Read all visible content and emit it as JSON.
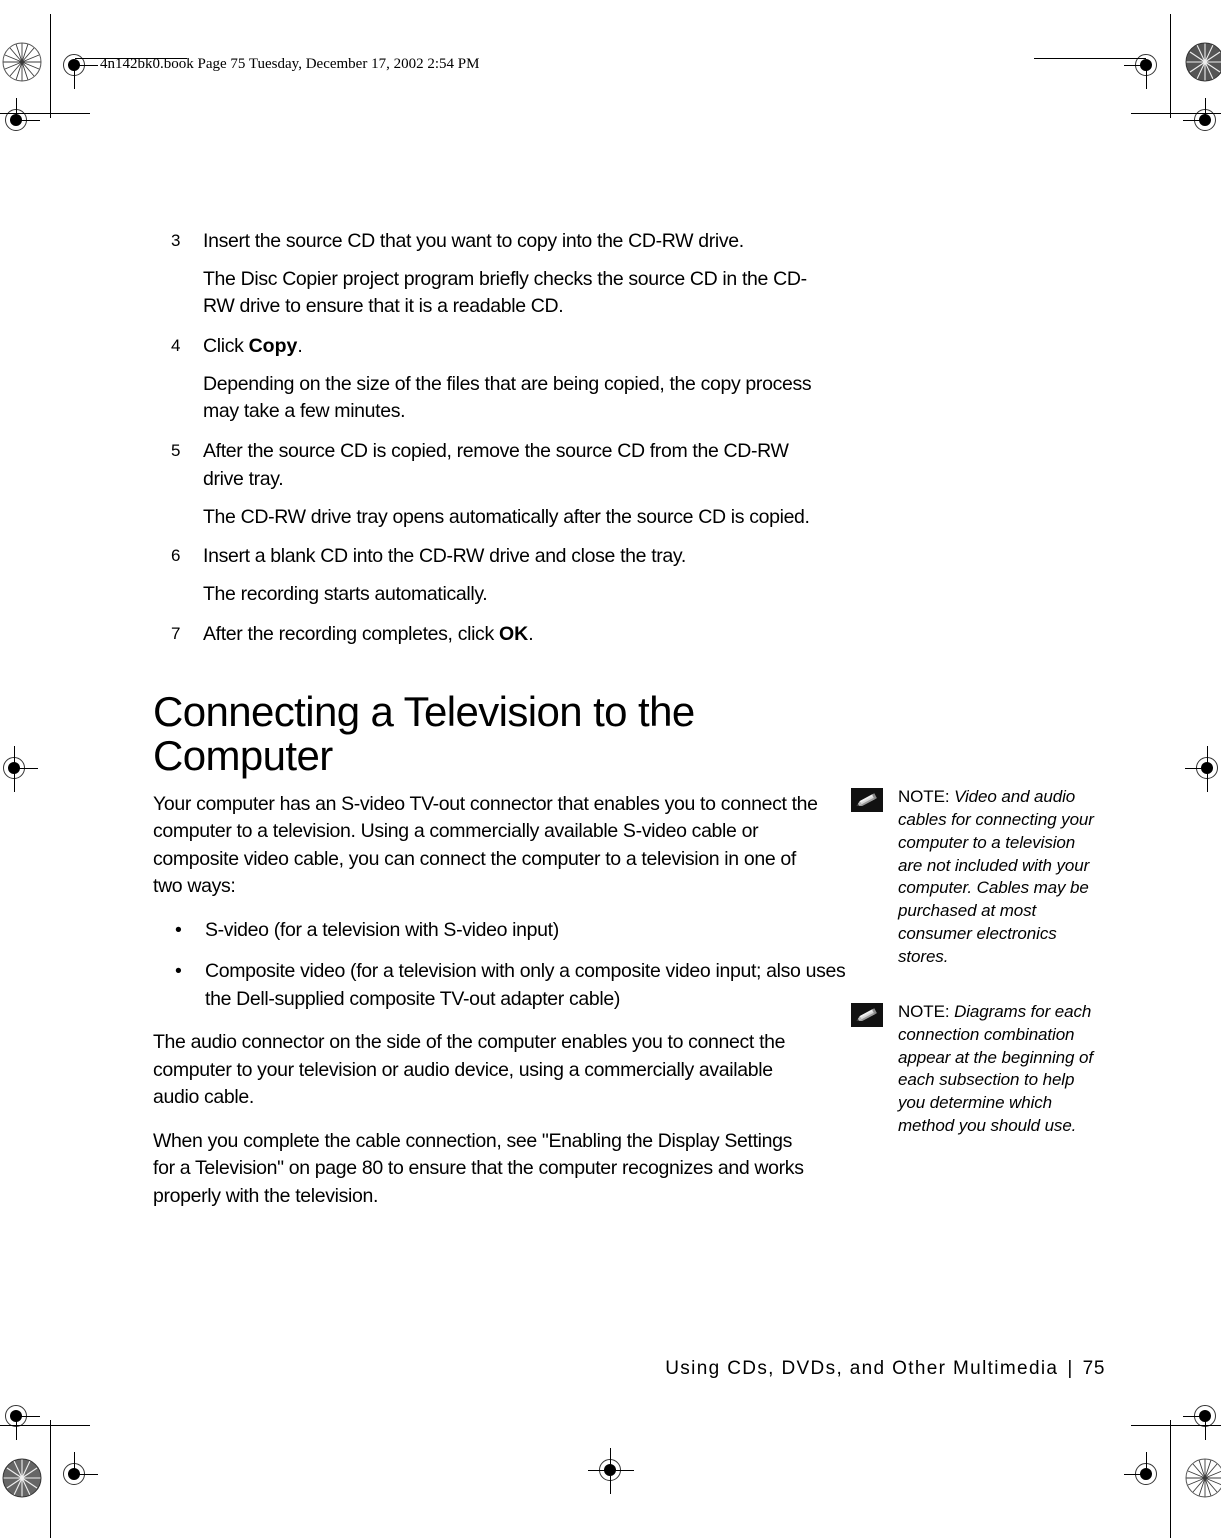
{
  "book_header": {
    "text": "4n142bk0.book  Page 75  Tuesday, December 17, 2002  2:54 PM"
  },
  "steps": [
    {
      "num": "3",
      "text": "Insert the source CD that you want to copy into the CD-RW drive.",
      "followup": "The Disc Copier project program briefly checks the source CD in the CD-RW drive to ensure that it is a readable CD."
    },
    {
      "num": "4",
      "text_before": "Click ",
      "bold": "Copy",
      "text_after": ".",
      "followup": "Depending on the size of the files that are being copied, the copy process may take a few minutes."
    },
    {
      "num": "5",
      "text": "After the source CD is copied, remove the source CD from the CD-RW drive tray.",
      "followup": "The CD-RW drive tray opens automatically after the source CD is copied."
    },
    {
      "num": "6",
      "text": "Insert a blank CD into the CD-RW drive and close the tray.",
      "followup": "The recording starts automatically."
    },
    {
      "num": "7",
      "text_before": "After the recording completes, click ",
      "bold": "OK",
      "text_after": ".",
      "followup": ""
    }
  ],
  "section": {
    "title_line1": "Connecting a Television to the",
    "title_line2": "Computer",
    "intro": "Your computer has an S-video TV-out connector that enables you to connect the computer to a television. Using a commercially available S-video cable or composite video cable, you can connect the computer to a television in one of two ways:",
    "bullet_glyph": "•",
    "bullets": [
      "S-video (for a television with S-video input)",
      "Composite video (for a television with only a composite video input; also uses the Dell-supplied composite TV-out adapter cable)"
    ],
    "para_audio": "The audio connector on the side of the computer enables you to connect the computer to your television or audio device, using a commercially available audio cable.",
    "para_enabling": "When you complete the cable connection, see \"Enabling the Display Settings for a Television\" on page 80 to ensure that the computer recognizes and works properly with the television."
  },
  "notes": [
    {
      "label": "NOTE: ",
      "text": "Video and audio cables for connecting your computer to a television are not included with your computer. Cables may be purchased at most consumer electronics stores.",
      "icon": "pencil-note-icon"
    },
    {
      "label": "NOTE: ",
      "text": "Diagrams for each connection combination appear at the beginning of each subsection to help you determine which method you should use.",
      "icon": "pencil-note-icon"
    }
  ],
  "footer": {
    "chapter": "Using CDs, DVDs, and Other Multimedia",
    "separator": "|",
    "page_number": "75"
  },
  "colors": {
    "text": "#000000",
    "background": "#ffffff",
    "note_icon_bg": "#111111"
  }
}
